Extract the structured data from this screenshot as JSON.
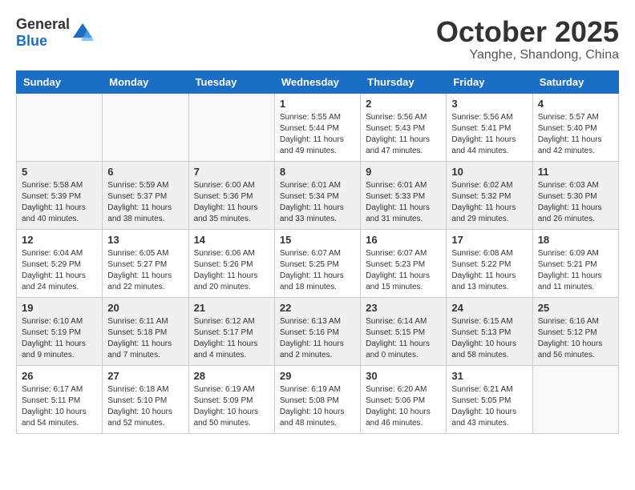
{
  "header": {
    "logo": {
      "general": "General",
      "blue": "Blue"
    },
    "month": "October 2025",
    "location": "Yanghe, Shandong, China"
  },
  "weekdays": [
    "Sunday",
    "Monday",
    "Tuesday",
    "Wednesday",
    "Thursday",
    "Friday",
    "Saturday"
  ],
  "weeks": [
    {
      "shaded": false,
      "days": [
        {
          "number": "",
          "info": ""
        },
        {
          "number": "",
          "info": ""
        },
        {
          "number": "",
          "info": ""
        },
        {
          "number": "1",
          "info": "Sunrise: 5:55 AM\nSunset: 5:44 PM\nDaylight: 11 hours\nand 49 minutes."
        },
        {
          "number": "2",
          "info": "Sunrise: 5:56 AM\nSunset: 5:43 PM\nDaylight: 11 hours\nand 47 minutes."
        },
        {
          "number": "3",
          "info": "Sunrise: 5:56 AM\nSunset: 5:41 PM\nDaylight: 11 hours\nand 44 minutes."
        },
        {
          "number": "4",
          "info": "Sunrise: 5:57 AM\nSunset: 5:40 PM\nDaylight: 11 hours\nand 42 minutes."
        }
      ]
    },
    {
      "shaded": true,
      "days": [
        {
          "number": "5",
          "info": "Sunrise: 5:58 AM\nSunset: 5:39 PM\nDaylight: 11 hours\nand 40 minutes."
        },
        {
          "number": "6",
          "info": "Sunrise: 5:59 AM\nSunset: 5:37 PM\nDaylight: 11 hours\nand 38 minutes."
        },
        {
          "number": "7",
          "info": "Sunrise: 6:00 AM\nSunset: 5:36 PM\nDaylight: 11 hours\nand 35 minutes."
        },
        {
          "number": "8",
          "info": "Sunrise: 6:01 AM\nSunset: 5:34 PM\nDaylight: 11 hours\nand 33 minutes."
        },
        {
          "number": "9",
          "info": "Sunrise: 6:01 AM\nSunset: 5:33 PM\nDaylight: 11 hours\nand 31 minutes."
        },
        {
          "number": "10",
          "info": "Sunrise: 6:02 AM\nSunset: 5:32 PM\nDaylight: 11 hours\nand 29 minutes."
        },
        {
          "number": "11",
          "info": "Sunrise: 6:03 AM\nSunset: 5:30 PM\nDaylight: 11 hours\nand 26 minutes."
        }
      ]
    },
    {
      "shaded": false,
      "days": [
        {
          "number": "12",
          "info": "Sunrise: 6:04 AM\nSunset: 5:29 PM\nDaylight: 11 hours\nand 24 minutes."
        },
        {
          "number": "13",
          "info": "Sunrise: 6:05 AM\nSunset: 5:27 PM\nDaylight: 11 hours\nand 22 minutes."
        },
        {
          "number": "14",
          "info": "Sunrise: 6:06 AM\nSunset: 5:26 PM\nDaylight: 11 hours\nand 20 minutes."
        },
        {
          "number": "15",
          "info": "Sunrise: 6:07 AM\nSunset: 5:25 PM\nDaylight: 11 hours\nand 18 minutes."
        },
        {
          "number": "16",
          "info": "Sunrise: 6:07 AM\nSunset: 5:23 PM\nDaylight: 11 hours\nand 15 minutes."
        },
        {
          "number": "17",
          "info": "Sunrise: 6:08 AM\nSunset: 5:22 PM\nDaylight: 11 hours\nand 13 minutes."
        },
        {
          "number": "18",
          "info": "Sunrise: 6:09 AM\nSunset: 5:21 PM\nDaylight: 11 hours\nand 11 minutes."
        }
      ]
    },
    {
      "shaded": true,
      "days": [
        {
          "number": "19",
          "info": "Sunrise: 6:10 AM\nSunset: 5:19 PM\nDaylight: 11 hours\nand 9 minutes."
        },
        {
          "number": "20",
          "info": "Sunrise: 6:11 AM\nSunset: 5:18 PM\nDaylight: 11 hours\nand 7 minutes."
        },
        {
          "number": "21",
          "info": "Sunrise: 6:12 AM\nSunset: 5:17 PM\nDaylight: 11 hours\nand 4 minutes."
        },
        {
          "number": "22",
          "info": "Sunrise: 6:13 AM\nSunset: 5:16 PM\nDaylight: 11 hours\nand 2 minutes."
        },
        {
          "number": "23",
          "info": "Sunrise: 6:14 AM\nSunset: 5:15 PM\nDaylight: 11 hours\nand 0 minutes."
        },
        {
          "number": "24",
          "info": "Sunrise: 6:15 AM\nSunset: 5:13 PM\nDaylight: 10 hours\nand 58 minutes."
        },
        {
          "number": "25",
          "info": "Sunrise: 6:16 AM\nSunset: 5:12 PM\nDaylight: 10 hours\nand 56 minutes."
        }
      ]
    },
    {
      "shaded": false,
      "days": [
        {
          "number": "26",
          "info": "Sunrise: 6:17 AM\nSunset: 5:11 PM\nDaylight: 10 hours\nand 54 minutes."
        },
        {
          "number": "27",
          "info": "Sunrise: 6:18 AM\nSunset: 5:10 PM\nDaylight: 10 hours\nand 52 minutes."
        },
        {
          "number": "28",
          "info": "Sunrise: 6:19 AM\nSunset: 5:09 PM\nDaylight: 10 hours\nand 50 minutes."
        },
        {
          "number": "29",
          "info": "Sunrise: 6:19 AM\nSunset: 5:08 PM\nDaylight: 10 hours\nand 48 minutes."
        },
        {
          "number": "30",
          "info": "Sunrise: 6:20 AM\nSunset: 5:06 PM\nDaylight: 10 hours\nand 46 minutes."
        },
        {
          "number": "31",
          "info": "Sunrise: 6:21 AM\nSunset: 5:05 PM\nDaylight: 10 hours\nand 43 minutes."
        },
        {
          "number": "",
          "info": ""
        }
      ]
    }
  ]
}
